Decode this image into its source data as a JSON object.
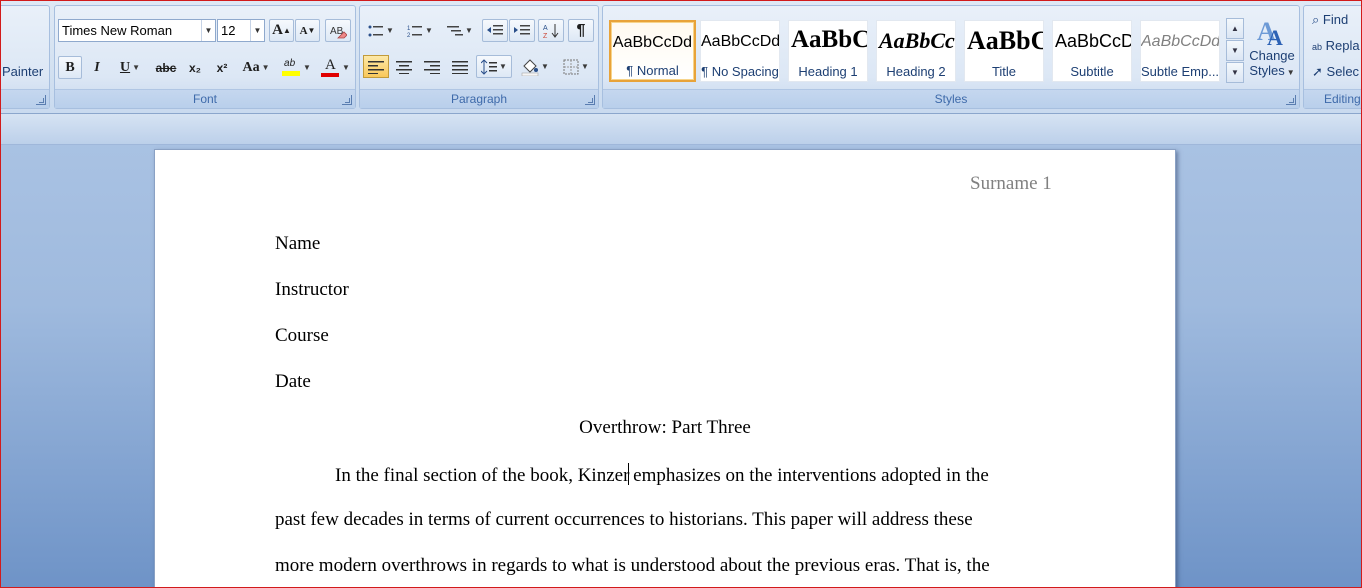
{
  "clipboard": {
    "painter_label": "Painter"
  },
  "font": {
    "group_label": "Font",
    "family": "Times New Roman",
    "size": "12",
    "grow_label": "A",
    "shrink_label": "A",
    "bold": "B",
    "italic": "I",
    "underline": "U",
    "strike": "abc",
    "subscript": "x₂",
    "superscript": "x²",
    "case": "Aa",
    "highlight_glyph": "ab",
    "color_glyph": "A",
    "highlight_color": "#ffff00",
    "font_color": "#e00000"
  },
  "paragraph": {
    "group_label": "Paragraph",
    "show_marks": "¶"
  },
  "styles": {
    "group_label": "Styles",
    "items": [
      {
        "sample": "AaBbCcDd",
        "name": "¶ Normal"
      },
      {
        "sample": "AaBbCcDd",
        "name": "¶ No Spacing"
      },
      {
        "sample": "AaBbC",
        "name": "Heading 1"
      },
      {
        "sample": "AaBbCc",
        "name": "Heading 2"
      },
      {
        "sample": "AaBbC",
        "name": "Title"
      },
      {
        "sample": "AaBbCcD",
        "name": "Subtitle"
      },
      {
        "sample": "AaBbCcDd",
        "name": "Subtle Emp..."
      }
    ],
    "change_styles_line1": "Change",
    "change_styles_line2": "Styles"
  },
  "editing": {
    "group_label": "Editing",
    "find": "Find",
    "replace": "Repla",
    "select": "Selec"
  },
  "document": {
    "header": "Surname 1",
    "name": "Name",
    "instructor": "Instructor",
    "course": "Course",
    "date": "Date",
    "title": "Overthrow: Part Three",
    "line1_a": "In the final section of the book, Kinzer",
    "line1_b": " emphasizes on the interventions adopted in the",
    "line2": "past few decades in terms of current occurrences to historians. This paper will address these",
    "line3": "more modern overthrows in regards to what is understood about the previous eras. That is, the"
  }
}
